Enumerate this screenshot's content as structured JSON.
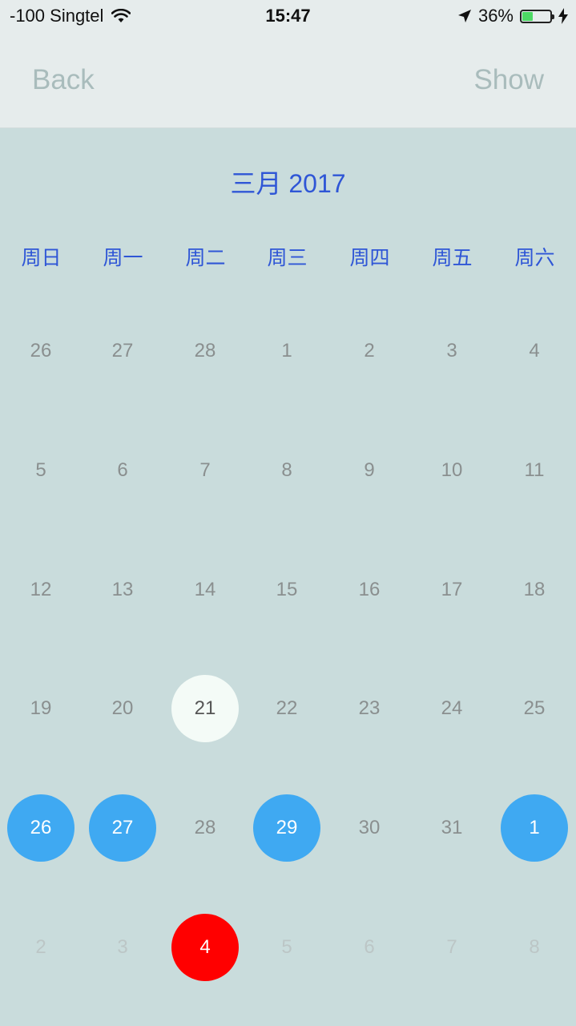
{
  "status_bar": {
    "carrier": "-100 Singtel",
    "time": "15:47",
    "battery_percent": "36%",
    "battery_level": 0.36
  },
  "nav": {
    "back_label": "Back",
    "show_label": "Show"
  },
  "calendar": {
    "month_title": "三月 2017",
    "weekdays": [
      "周日",
      "周一",
      "周二",
      "周三",
      "周四",
      "周五",
      "周六"
    ],
    "weeks": [
      [
        {
          "d": "26",
          "s": "normal"
        },
        {
          "d": "27",
          "s": "normal"
        },
        {
          "d": "28",
          "s": "normal"
        },
        {
          "d": "1",
          "s": "normal"
        },
        {
          "d": "2",
          "s": "normal"
        },
        {
          "d": "3",
          "s": "normal"
        },
        {
          "d": "4",
          "s": "normal"
        }
      ],
      [
        {
          "d": "5",
          "s": "normal"
        },
        {
          "d": "6",
          "s": "normal"
        },
        {
          "d": "7",
          "s": "normal"
        },
        {
          "d": "8",
          "s": "normal"
        },
        {
          "d": "9",
          "s": "normal"
        },
        {
          "d": "10",
          "s": "normal"
        },
        {
          "d": "11",
          "s": "normal"
        }
      ],
      [
        {
          "d": "12",
          "s": "normal"
        },
        {
          "d": "13",
          "s": "normal"
        },
        {
          "d": "14",
          "s": "normal"
        },
        {
          "d": "15",
          "s": "normal"
        },
        {
          "d": "16",
          "s": "normal"
        },
        {
          "d": "17",
          "s": "normal"
        },
        {
          "d": "18",
          "s": "normal"
        }
      ],
      [
        {
          "d": "19",
          "s": "normal"
        },
        {
          "d": "20",
          "s": "normal"
        },
        {
          "d": "21",
          "s": "today"
        },
        {
          "d": "22",
          "s": "normal"
        },
        {
          "d": "23",
          "s": "normal"
        },
        {
          "d": "24",
          "s": "normal"
        },
        {
          "d": "25",
          "s": "normal"
        }
      ],
      [
        {
          "d": "26",
          "s": "selected"
        },
        {
          "d": "27",
          "s": "selected"
        },
        {
          "d": "28",
          "s": "normal"
        },
        {
          "d": "29",
          "s": "selected"
        },
        {
          "d": "30",
          "s": "normal"
        },
        {
          "d": "31",
          "s": "normal"
        },
        {
          "d": "1",
          "s": "selected"
        }
      ],
      [
        {
          "d": "2",
          "s": "faded"
        },
        {
          "d": "3",
          "s": "faded"
        },
        {
          "d": "4",
          "s": "marked"
        },
        {
          "d": "5",
          "s": "faded"
        },
        {
          "d": "6",
          "s": "faded"
        },
        {
          "d": "7",
          "s": "faded"
        },
        {
          "d": "8",
          "s": "faded"
        }
      ]
    ]
  },
  "colors": {
    "background": "#c9dcdc",
    "header": "#e6ecec",
    "accent_text": "#2f56d6",
    "selected": "#3fa9f2",
    "today": "#f4fbf7",
    "marked": "#ff0000"
  },
  "icons": [
    "wifi-icon",
    "location-arrow-icon",
    "battery-icon",
    "charging-bolt-icon"
  ]
}
